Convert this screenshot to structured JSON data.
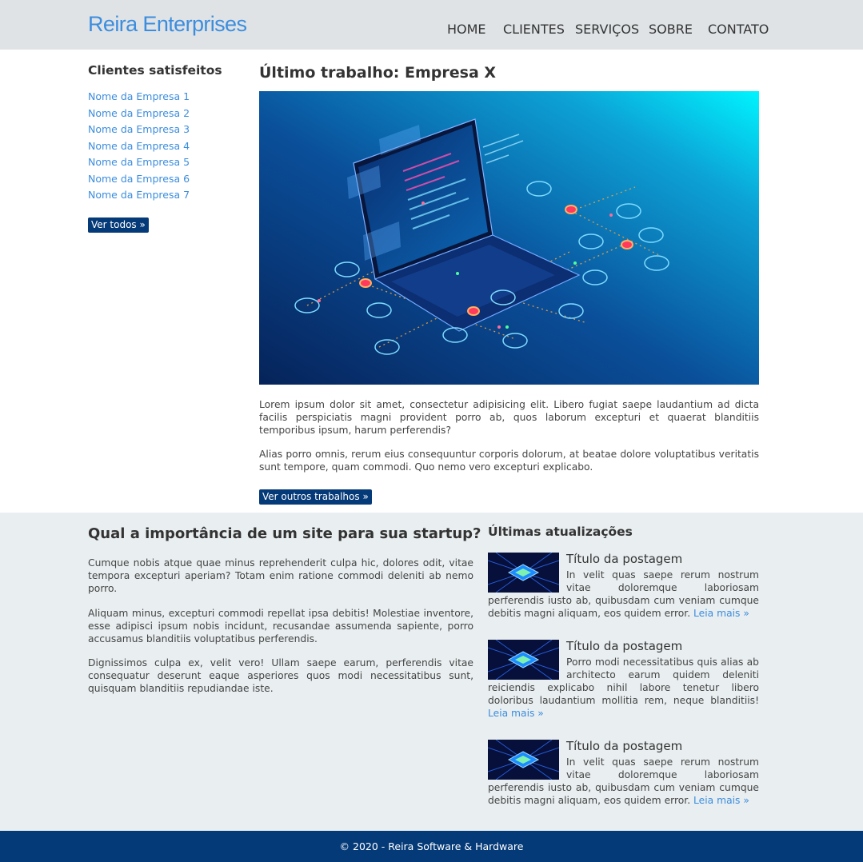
{
  "header": {
    "logo": "Reira Enterprises",
    "nav": [
      {
        "label": "HOME"
      },
      {
        "label": "CLIENTES"
      },
      {
        "label": "SERVIÇOS"
      },
      {
        "label": "SOBRE"
      },
      {
        "label": "CONTATO"
      }
    ]
  },
  "sidebar": {
    "title": "Clientes satisfeitos",
    "clients": [
      "Nome da Empresa 1",
      "Nome da Empresa 2",
      "Nome da Empresa 3",
      "Nome da Empresa 4",
      "Nome da Empresa 5",
      "Nome da Empresa 6",
      "Nome da Empresa 7"
    ],
    "button": "Ver todos »"
  },
  "main": {
    "title": "Último trabalho: Empresa X",
    "paragraphs": [
      "Lorem ipsum dolor sit amet, consectetur adipisicing elit. Libero fugiat saepe laudantium ad dicta facilis perspiciatis magni provident porro ab, quos laborum excepturi et quaerat blanditiis temporibus ipsum, harum perferendis?",
      "Alias porro omnis, rerum eius consequuntur corporis dolorum, at beatae dolore voluptatibus veritatis sunt tempore, quam commodi. Quo nemo vero excepturi explicabo."
    ],
    "button": "Ver outros trabalhos »"
  },
  "band": {
    "title": "Qual a importância de um site para sua startup?",
    "paragraphs": [
      "Cumque nobis atque quae minus reprehenderit culpa hic, dolores odit, vitae tempora excepturi aperiam? Totam enim ratione commodi deleniti ab nemo porro.",
      "Aliquam minus, excepturi commodi repellat ipsa debitis! Molestiae inventore, esse adipisci ipsum nobis incidunt, recusandae assumenda sapiente, porro accusamus blanditiis voluptatibus perferendis.",
      "Dignissimos culpa ex, velit vero! Ullam saepe earum, perferendis vitae consequatur deserunt eaque asperiores quos modi necessitatibus sunt, quisquam blanditiis repudiandae iste."
    ],
    "updates_title": "Últimas atualizações",
    "posts": [
      {
        "title": "Título da postagem",
        "text": "In velit quas saepe rerum nostrum vitae doloremque laboriosam perferendis iusto ab, quibusdam cum veniam cumque debitis magni aliquam, eos quidem error.",
        "more": "Leia mais »"
      },
      {
        "title": "Título da postagem",
        "text": "Porro modi necessitatibus quis alias ab architecto earum quidem deleniti reiciendis explicabo nihil labore tenetur libero doloribus laudantium mollitia rem, neque blanditiis!",
        "more": "Leia mais »"
      },
      {
        "title": "Título da postagem",
        "text": "In velit quas saepe rerum nostrum vitae doloremque laboriosam perferendis iusto ab, quibusdam cum veniam cumque debitis magni aliquam, eos quidem error.",
        "more": "Leia mais »"
      }
    ]
  },
  "footer": {
    "text": "© 2020 - Reira Software & Hardware"
  },
  "colors": {
    "accent": "#3c8dde",
    "button": "#053a78",
    "header_bg": "#dfe3e6",
    "band_bg": "#e9eef0",
    "footer_bg": "#053a78"
  }
}
